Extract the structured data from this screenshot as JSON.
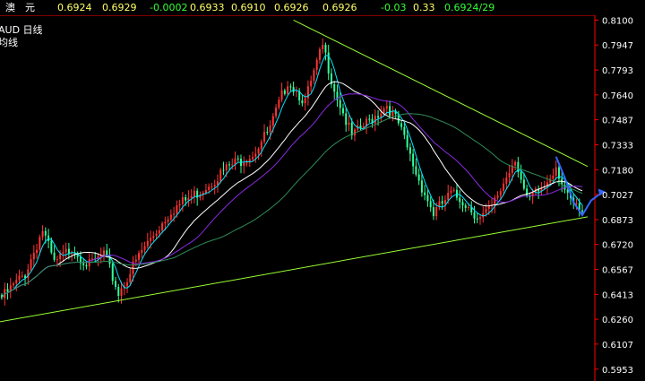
{
  "quote": {
    "name": "澳　元",
    "open": "0.6924",
    "prev": "0.6929",
    "change": "-0.0002",
    "high": "0.6933",
    "low": "0.6910",
    "bid": "0.6926",
    "ask": "0.6926",
    "change_pct": "-0.03",
    "volume": "0.33",
    "last": "0.6924/29"
  },
  "legend": {
    "symbol_line": "AUD  日线",
    "sub_line": "均线"
  },
  "colors": {
    "background": "#000000",
    "frame": "#ff0000",
    "candle_up": "#ff3333",
    "candle_down": "#33ff99",
    "ma_short": "#00e5ff",
    "ma_mid": "#ffffff",
    "ma_long": "#8a2be2",
    "ma_longest": "#2e8b57",
    "trendline": "#99ff33",
    "forecast": "#3366ff"
  },
  "chart_data": {
    "type": "candlestick",
    "y_ticks": [
      "0.8100",
      "0.7947",
      "0.7793",
      "0.7640",
      "0.7487",
      "0.7333",
      "0.7180",
      "0.7027",
      "0.6873",
      "0.6720",
      "0.6567",
      "0.6413",
      "0.6260",
      "0.6107",
      "0.5953"
    ],
    "ylim": [
      0.588,
      0.813
    ],
    "x_count": 200,
    "anchors": [
      {
        "i": 0,
        "v": 0.641
      },
      {
        "i": 8,
        "v": 0.656
      },
      {
        "i": 14,
        "v": 0.683
      },
      {
        "i": 18,
        "v": 0.662
      },
      {
        "i": 24,
        "v": 0.672
      },
      {
        "i": 30,
        "v": 0.661
      },
      {
        "i": 35,
        "v": 0.668
      },
      {
        "i": 40,
        "v": 0.644
      },
      {
        "i": 48,
        "v": 0.67
      },
      {
        "i": 58,
        "v": 0.695
      },
      {
        "i": 68,
        "v": 0.707
      },
      {
        "i": 78,
        "v": 0.722
      },
      {
        "i": 86,
        "v": 0.73
      },
      {
        "i": 92,
        "v": 0.745
      },
      {
        "i": 98,
        "v": 0.775
      },
      {
        "i": 104,
        "v": 0.762
      },
      {
        "i": 110,
        "v": 0.796
      },
      {
        "i": 114,
        "v": 0.77
      },
      {
        "i": 120,
        "v": 0.74
      },
      {
        "i": 126,
        "v": 0.75
      },
      {
        "i": 132,
        "v": 0.76
      },
      {
        "i": 136,
        "v": 0.748
      },
      {
        "i": 142,
        "v": 0.718
      },
      {
        "i": 148,
        "v": 0.693
      },
      {
        "i": 154,
        "v": 0.705
      },
      {
        "i": 158,
        "v": 0.701
      },
      {
        "i": 164,
        "v": 0.69
      },
      {
        "i": 168,
        "v": 0.696
      },
      {
        "i": 176,
        "v": 0.728
      },
      {
        "i": 180,
        "v": 0.7
      },
      {
        "i": 186,
        "v": 0.71
      },
      {
        "i": 190,
        "v": 0.723
      },
      {
        "i": 194,
        "v": 0.702
      },
      {
        "i": 199,
        "v": 0.6924
      }
    ],
    "moving_averages": [
      {
        "name": "ma_short",
        "period": 5
      },
      {
        "name": "ma_mid",
        "period": 20
      },
      {
        "name": "ma_long",
        "period": 30
      },
      {
        "name": "ma_longest",
        "period": 60
      }
    ],
    "trendlines": [
      {
        "name": "support",
        "from": {
          "i": -2,
          "v": 0.624
        },
        "to": {
          "i": 199,
          "v": 0.689
        }
      },
      {
        "name": "resistance",
        "from": {
          "i": 100,
          "v": 0.81
        },
        "to": {
          "i": 199,
          "v": 0.72
        }
      }
    ],
    "forecast": [
      {
        "i": 190,
        "v": 0.726
      },
      {
        "i": 193,
        "v": 0.713
      },
      {
        "i": 196,
        "v": 0.698
      },
      {
        "i": 199,
        "v": 0.69
      },
      {
        "i": 202,
        "v": 0.699
      },
      {
        "i": 205,
        "v": 0.703
      }
    ]
  }
}
